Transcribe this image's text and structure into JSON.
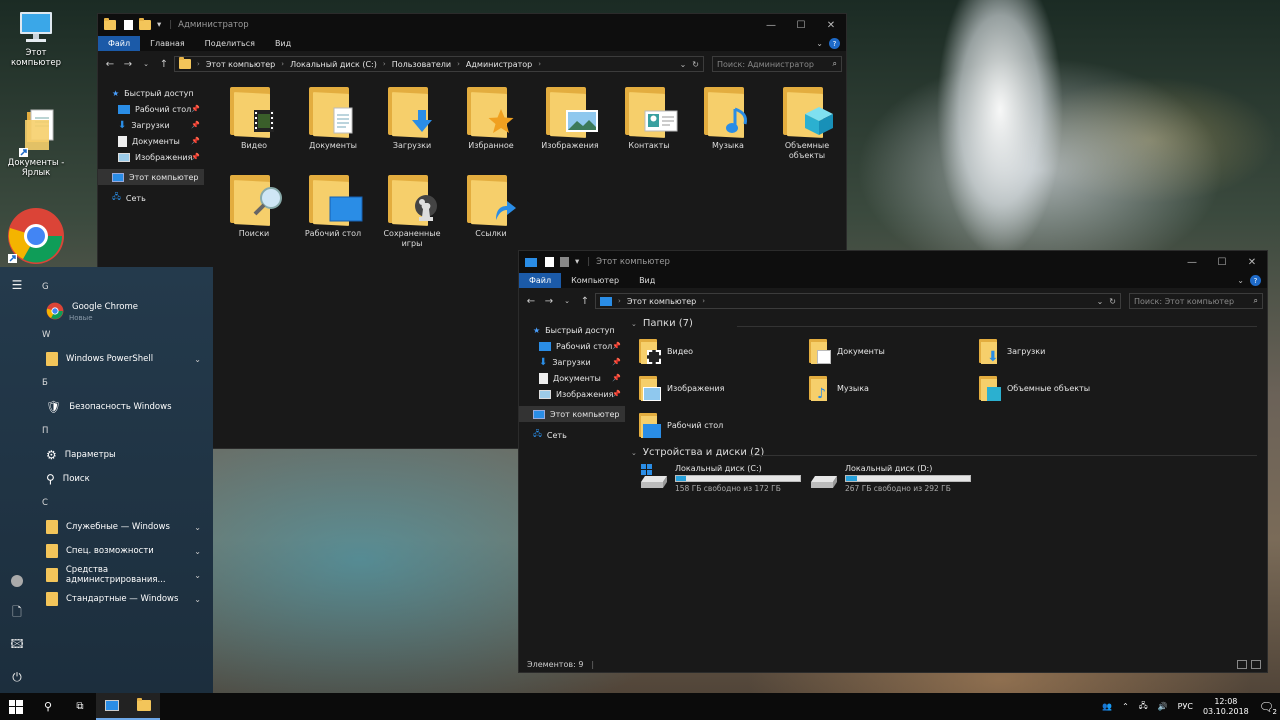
{
  "desktop": {
    "icons": [
      {
        "label": "Этот компьютер",
        "icon": "computer-icon"
      },
      {
        "label": "Документы - Ярлык",
        "icon": "document-shortcut-icon"
      },
      {
        "label": "",
        "icon": "chrome-icon"
      }
    ]
  },
  "win1": {
    "title": "Администратор",
    "ribbon_tabs": [
      "Файл",
      "Главная",
      "Поделиться",
      "Вид"
    ],
    "breadcrumb": [
      "Этот компьютер",
      "Локальный диск (C:)",
      "Пользователи",
      "Администратор"
    ],
    "search_placeholder": "Поиск: Администратор",
    "nav": [
      {
        "label": "Быстрый доступ",
        "level": 0
      },
      {
        "label": "Рабочий стол",
        "level": 1,
        "pinned": true
      },
      {
        "label": "Загрузки",
        "level": 1,
        "pinned": true
      },
      {
        "label": "Документы",
        "level": 1,
        "pinned": true
      },
      {
        "label": "Изображения",
        "level": 1,
        "pinned": true
      },
      {
        "label": "Этот компьютер",
        "level": 0,
        "selected": true
      },
      {
        "label": "Сеть",
        "level": 0
      }
    ],
    "items": [
      "Видео",
      "Документы",
      "Загрузки",
      "Избранное",
      "Изображения",
      "Контакты",
      "Музыка",
      "Объемные объекты",
      "Поиски",
      "Рабочий стол",
      "Сохраненные игры",
      "Ссылки"
    ]
  },
  "win2": {
    "title": "Этот компьютер",
    "ribbon_tabs": [
      "Файл",
      "Компьютер",
      "Вид"
    ],
    "breadcrumb": [
      "Этот компьютер"
    ],
    "search_placeholder": "Поиск: Этот компьютер",
    "nav": [
      {
        "label": "Быстрый доступ",
        "level": 0
      },
      {
        "label": "Рабочий стол",
        "level": 1
      },
      {
        "label": "Загрузки",
        "level": 1
      },
      {
        "label": "Документы",
        "level": 1
      },
      {
        "label": "Изображения",
        "level": 1
      },
      {
        "label": "Этот компьютер",
        "level": 0
      },
      {
        "label": "Сеть",
        "level": 0
      }
    ],
    "folders_header": "Папки (7)",
    "folders": [
      "Видео",
      "Документы",
      "Загрузки",
      "Изображения",
      "Музыка",
      "Объемные объекты",
      "Рабочий стол"
    ],
    "drives_header": "Устройства и диски (2)",
    "drives": [
      {
        "name": "Локальный диск (C:)",
        "free": "158 ГБ свободно из 172 ГБ",
        "used_fraction": 0.08
      },
      {
        "name": "Локальный диск (D:)",
        "free": "267 ГБ свободно из 292 ГБ",
        "used_fraction": 0.09
      }
    ],
    "status": "Элементов: 9"
  },
  "start": {
    "groups": [
      {
        "letter": "G",
        "apps": [
          {
            "label": "Google Chrome",
            "sub": "Новые",
            "icon": "chrome-icon"
          }
        ]
      },
      {
        "letter": "W",
        "apps": [
          {
            "label": "Windows PowerShell",
            "icon": "folder-icon",
            "expand": true
          }
        ]
      },
      {
        "letter": "Б",
        "apps": [
          {
            "label": "Безопасность Windows",
            "icon": "shield-icon"
          }
        ]
      },
      {
        "letter": "П",
        "apps": [
          {
            "label": "Параметры",
            "icon": "gear-icon"
          },
          {
            "label": "Поиск",
            "icon": "search-icon"
          }
        ]
      },
      {
        "letter": "С",
        "apps": [
          {
            "label": "Служебные — Windows",
            "icon": "folder-icon",
            "expand": true
          },
          {
            "label": "Спец. возможности",
            "icon": "folder-icon",
            "expand": true
          },
          {
            "label": "Средства администрирования...",
            "icon": "folder-icon",
            "expand": true
          },
          {
            "label": "Стандартные — Windows",
            "icon": "folder-icon",
            "expand": true
          }
        ]
      }
    ]
  },
  "taskbar": {
    "lang": "РУС",
    "time": "12:08",
    "date": "03.10.2018",
    "notification_count": "2"
  }
}
